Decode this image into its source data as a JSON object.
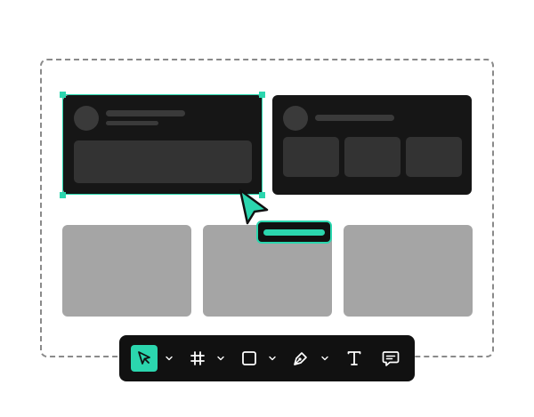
{
  "colors": {
    "accent": "#2bd6ae",
    "dark_card": "#161616",
    "placeholder": "#3a3a3a",
    "light_card": "#a5a5a5",
    "toolbar": "#111111"
  },
  "canvas": {
    "selected_card": "card-a",
    "cards_dark": [
      "card-a",
      "card-b"
    ],
    "cards_light_count": 3
  },
  "toolbar": {
    "tools": [
      {
        "icon": "cursor-arrow-icon",
        "active": true,
        "has_menu": true
      },
      {
        "icon": "frame-hash-icon",
        "active": false,
        "has_menu": true
      },
      {
        "icon": "rectangle-icon",
        "active": false,
        "has_menu": true
      },
      {
        "icon": "pen-tool-icon",
        "active": false,
        "has_menu": true
      },
      {
        "icon": "text-icon",
        "active": false,
        "has_menu": false
      },
      {
        "icon": "comment-icon",
        "active": false,
        "has_menu": false
      }
    ]
  }
}
